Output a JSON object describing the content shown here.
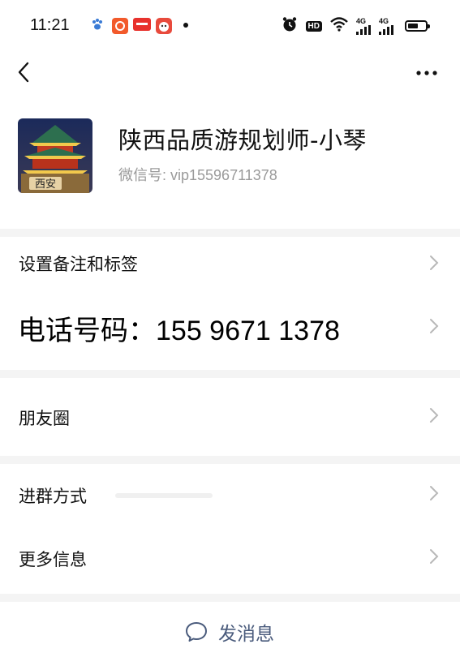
{
  "status_bar": {
    "time": "11:21",
    "hd_label": "HD",
    "net1": "4G",
    "net2": "4G",
    "battery_level": 0.6
  },
  "nav": {
    "back_icon": "chevron-left-icon",
    "more_icon": "more-dots-icon"
  },
  "profile": {
    "name": "陕西品质游规划师-小琴",
    "wechat_id": "微信号: vip15596711378",
    "avatar_text": "西安"
  },
  "rows": {
    "remark_tags": "设置备注和标签",
    "phone": "电话号码：155 9671 1378",
    "moments": "朋友圈",
    "group_join": "进群方式",
    "more_info": "更多信息"
  },
  "actions": {
    "send_message": "发消息"
  },
  "colors": {
    "link": "#4a5b7c",
    "secondary_text": "#9a9a9a",
    "chevron": "#b8b8b8",
    "section_bg": "#f4f4f4"
  }
}
